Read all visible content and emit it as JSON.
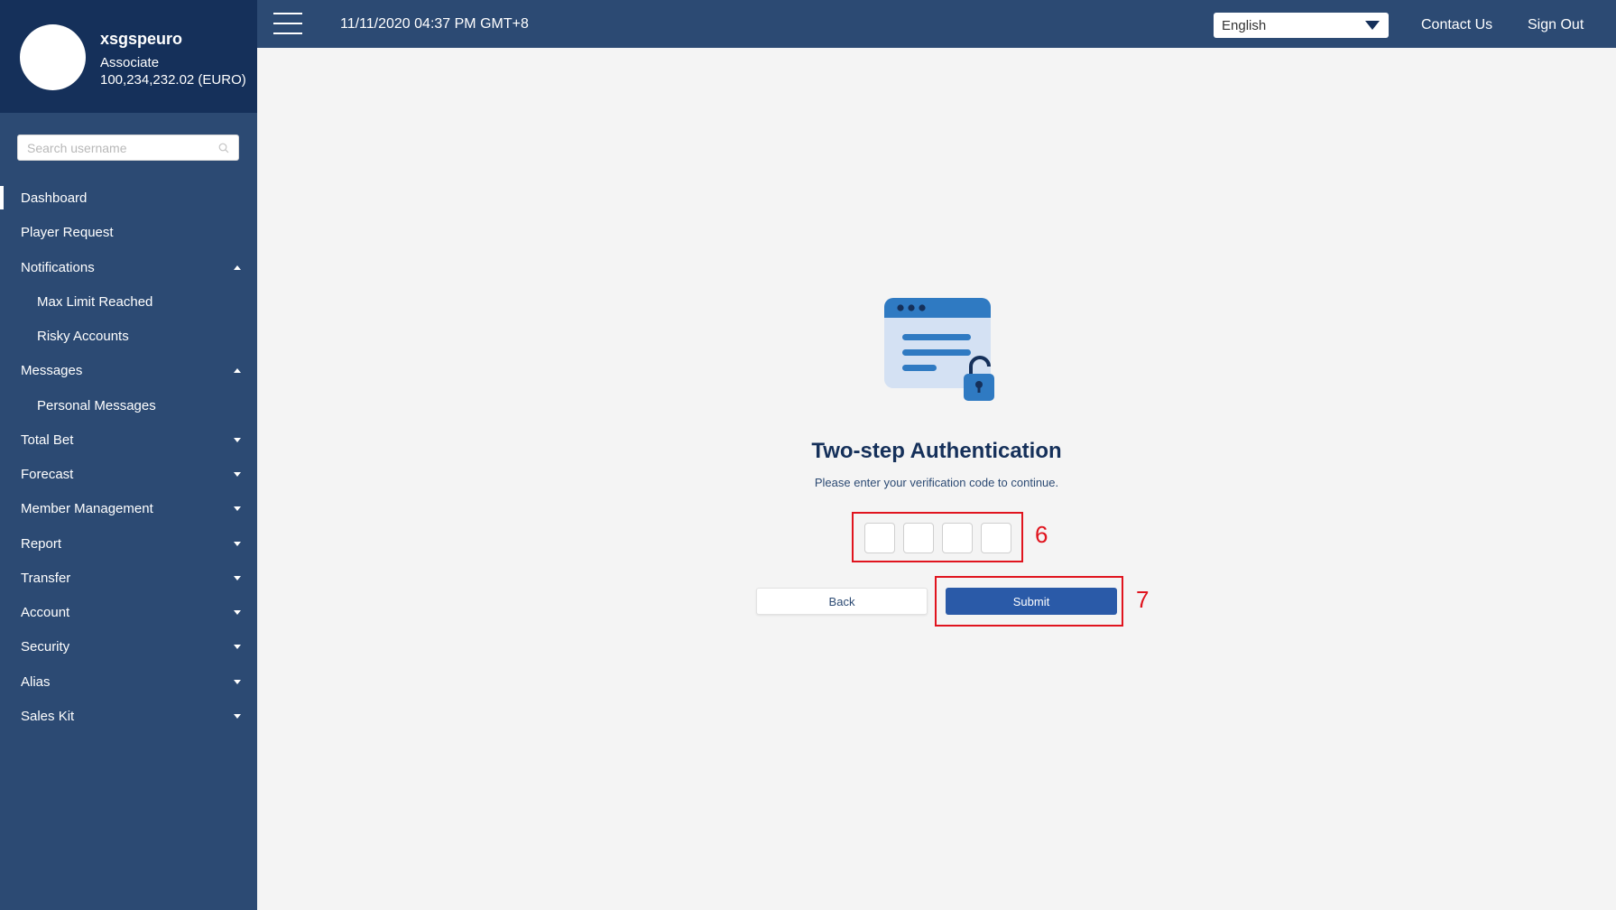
{
  "profile": {
    "username": "xsgspeuro",
    "role": "Associate",
    "balance": "100,234,232.02 (EURO)"
  },
  "search": {
    "placeholder": "Search username"
  },
  "nav": {
    "items": [
      {
        "label": "Dashboard",
        "level": 0,
        "active": true,
        "caret": ""
      },
      {
        "label": "Player Request",
        "level": 0,
        "caret": ""
      },
      {
        "label": "Notifications",
        "level": 0,
        "caret": "up"
      },
      {
        "label": "Max Limit Reached",
        "level": 1,
        "caret": ""
      },
      {
        "label": "Risky Accounts",
        "level": 1,
        "caret": ""
      },
      {
        "label": "Messages",
        "level": 0,
        "caret": "up"
      },
      {
        "label": "Personal Messages",
        "level": 1,
        "caret": ""
      },
      {
        "label": "Total Bet",
        "level": 0,
        "caret": "down"
      },
      {
        "label": "Forecast",
        "level": 0,
        "caret": "down"
      },
      {
        "label": "Member Management",
        "level": 0,
        "caret": "down"
      },
      {
        "label": "Report",
        "level": 0,
        "caret": "down"
      },
      {
        "label": "Transfer",
        "level": 0,
        "caret": "down"
      },
      {
        "label": "Account",
        "level": 0,
        "caret": "down"
      },
      {
        "label": "Security",
        "level": 0,
        "caret": "down"
      },
      {
        "label": "Alias",
        "level": 0,
        "caret": "down"
      },
      {
        "label": "Sales Kit",
        "level": 0,
        "caret": "down"
      }
    ]
  },
  "topbar": {
    "datetime": "11/11/2020 04:37 PM GMT+8",
    "language": "English",
    "contact_label": "Contact Us",
    "signout_label": "Sign Out"
  },
  "auth": {
    "title": "Two-step Authentication",
    "subtitle": "Please enter your verification code to continue.",
    "code_values": [
      "",
      "",
      "",
      ""
    ],
    "back_label": "Back",
    "submit_label": "Submit",
    "marker_code": "6",
    "marker_submit": "7"
  },
  "colors": {
    "sidebar": "#2c4a73",
    "profile_bg": "#15305a",
    "primary": "#2a5aa8",
    "highlight": "#e0141e"
  }
}
